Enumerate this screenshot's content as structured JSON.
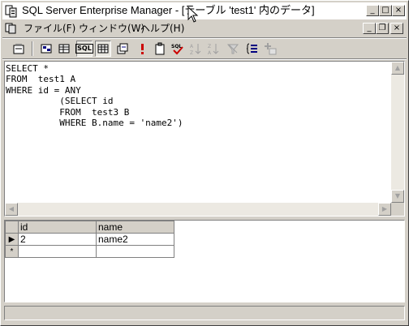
{
  "window": {
    "title": "SQL Server Enterprise Manager - [テーブル 'test1' 内のデータ]",
    "minimize_icon": "minimize-icon",
    "maximize_icon": "maximize-icon",
    "close_icon": "close-icon"
  },
  "menu": {
    "items": [
      {
        "label": "ファイル(F)"
      },
      {
        "label": "ウィンドウ(W)"
      },
      {
        "label": "ヘルプ(H)"
      }
    ]
  },
  "toolbar": {
    "tools": [
      "properties-icon",
      "diagram-pane-icon",
      "grid-pane-icon",
      "sql-pane-icon",
      "results-pane-icon",
      "change-query-type-icon",
      "run-icon",
      "verify-sql-icon",
      "sort-ascending-icon",
      "sort-descending-icon",
      "remove-filter-icon",
      "group-by-icon",
      "add-table-icon"
    ],
    "sql_label": "SQL"
  },
  "sql": {
    "text": "SELECT *\nFROM  test1 A\nWHERE id = ANY\n          (SELECT id\n          FROM  test3 B\n          WHERE B.name = 'name2')"
  },
  "grid": {
    "columns": [
      "id",
      "name"
    ],
    "rows": [
      {
        "marker": "▶",
        "id": "2",
        "name": "name2"
      },
      {
        "marker": "*",
        "id": "",
        "name": ""
      }
    ]
  },
  "colors": {
    "face": "#d4d0c8",
    "run_icon": "#cc0000"
  }
}
